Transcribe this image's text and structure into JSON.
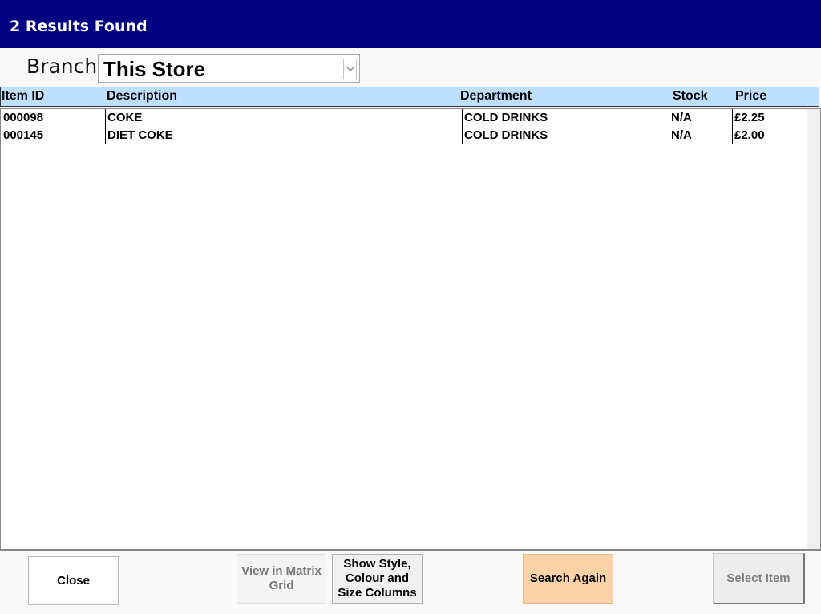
{
  "window": {
    "title": "2 Results Found"
  },
  "branch": {
    "label": "Branch",
    "selected": "This Store",
    "icon": "chevron-down-icon"
  },
  "table": {
    "columns": [
      "Item ID",
      "Description",
      "Department",
      "Stock",
      "Price"
    ],
    "rows": [
      [
        "000098",
        "COKE",
        "COLD DRINKS",
        "N/A",
        "£2.25"
      ],
      [
        "000145",
        "DIET COKE",
        "COLD DRINKS",
        "N/A",
        "£2.00"
      ]
    ]
  },
  "buttons": {
    "close": "Close",
    "matrix": "View in Matrix Grid",
    "show_columns": "Show Style, Colour and Size Columns",
    "search_again": "Search Again",
    "select_item": "Select Item"
  },
  "colors": {
    "titlebar": "#000080",
    "header_row": "#bfdfff",
    "search_button": "#fbd3a6"
  }
}
